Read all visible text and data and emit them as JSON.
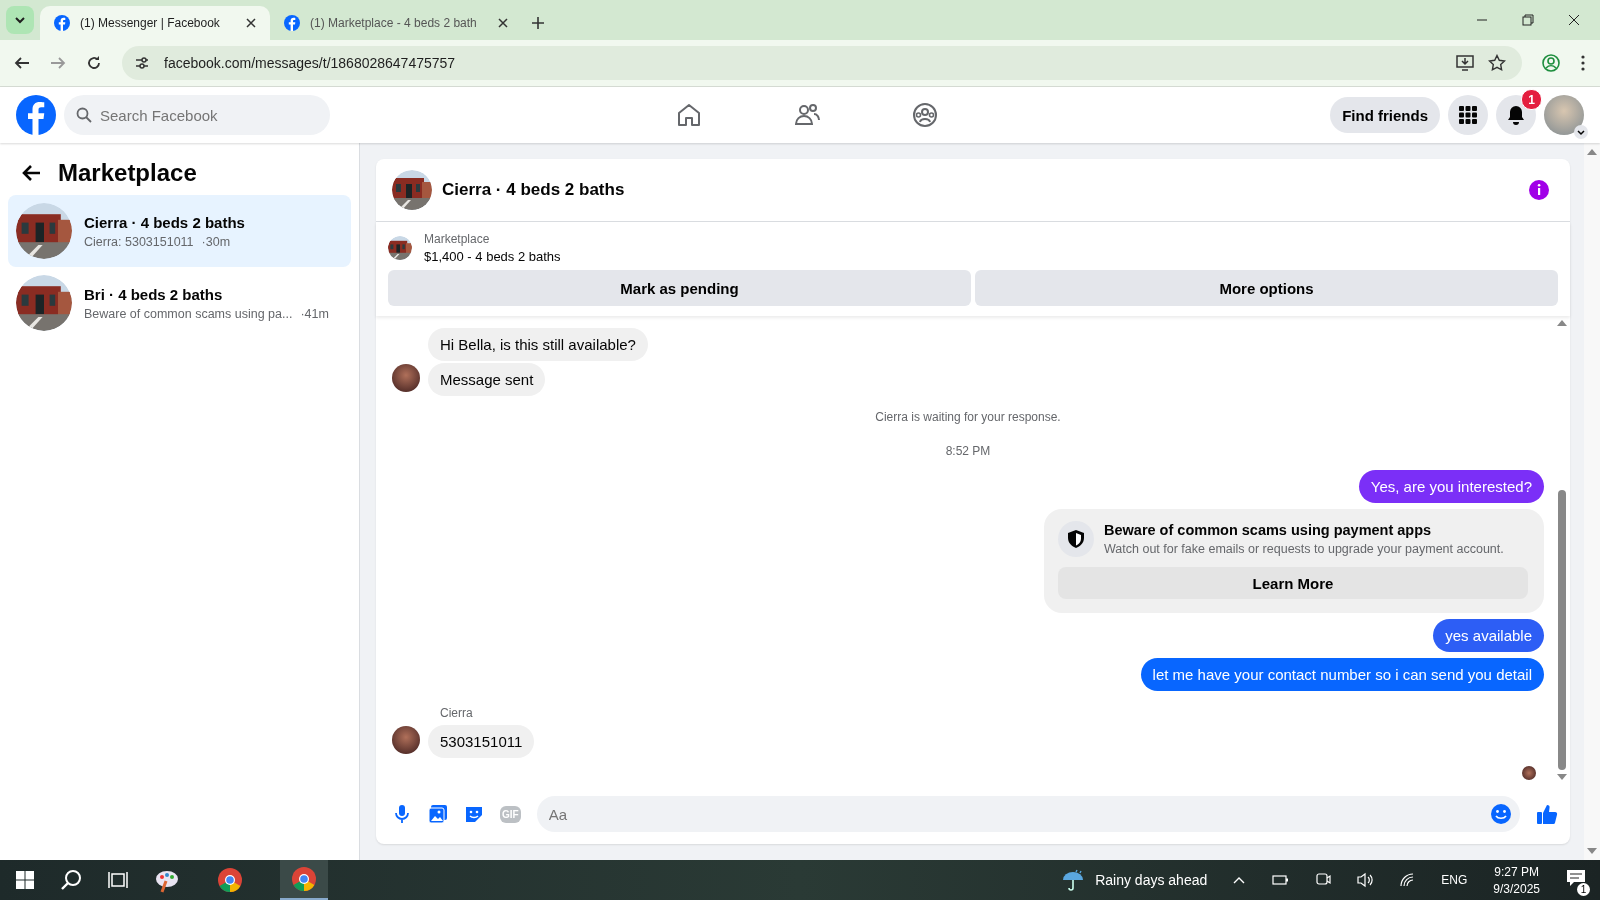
{
  "browser": {
    "tabs": [
      {
        "title": "(1) Messenger | Facebook",
        "selected": true
      },
      {
        "title": "(1) Marketplace - 4 beds 2 bath",
        "selected": false
      }
    ],
    "url": "facebook.com/messages/t/1868028647475757"
  },
  "header": {
    "search_placeholder": "Search Facebook",
    "find_friends": "Find friends",
    "notification_count": "1"
  },
  "sidebar": {
    "title": "Marketplace",
    "items": [
      {
        "title": "Cierra · 4 beds 2 baths",
        "preview": "Cierra: 5303151011",
        "time": "·30m",
        "selected": true
      },
      {
        "title": "Bri · 4 beds 2 baths",
        "preview": "Beware of common scams using pa...",
        "time": "·41m",
        "selected": false
      }
    ]
  },
  "conversation": {
    "title": "Cierra · 4 beds 2 baths",
    "listing": {
      "label": "Marketplace",
      "price": "$1,400 - 4 beds 2 baths"
    },
    "actions": [
      "Mark as pending",
      "More options"
    ],
    "messages": [
      {
        "kind": "incoming",
        "text": "Hi Bella, is this still available?",
        "avatar": false
      },
      {
        "kind": "incoming",
        "text": "Message sent",
        "avatar": true
      },
      {
        "kind": "notice",
        "text": "Cierra is waiting for your response."
      },
      {
        "kind": "time",
        "text": "8:52 PM"
      },
      {
        "kind": "outgoing",
        "text": "Yes, are you interested?",
        "color": "#7b2ff7"
      },
      {
        "kind": "warning",
        "title": "Beware of common scams using payment apps",
        "body": "Watch out for fake emails or requests to upgrade your payment account.",
        "button": "Learn More"
      },
      {
        "kind": "outgoing",
        "text": "yes available",
        "color": "#2d5ef5"
      },
      {
        "kind": "outgoing",
        "text": "let me have your contact number so i can send you detail",
        "color": "#0866ff"
      },
      {
        "kind": "sender",
        "text": "Cierra"
      },
      {
        "kind": "incoming",
        "text": "5303151011",
        "avatar": true
      }
    ]
  },
  "composer": {
    "placeholder": "Aa",
    "gif": "GIF"
  },
  "taskbar": {
    "weather": "Rainy days ahead",
    "language": "ENG",
    "time": "9:27 PM",
    "date": "9/3/2025",
    "notification_count": "1"
  }
}
